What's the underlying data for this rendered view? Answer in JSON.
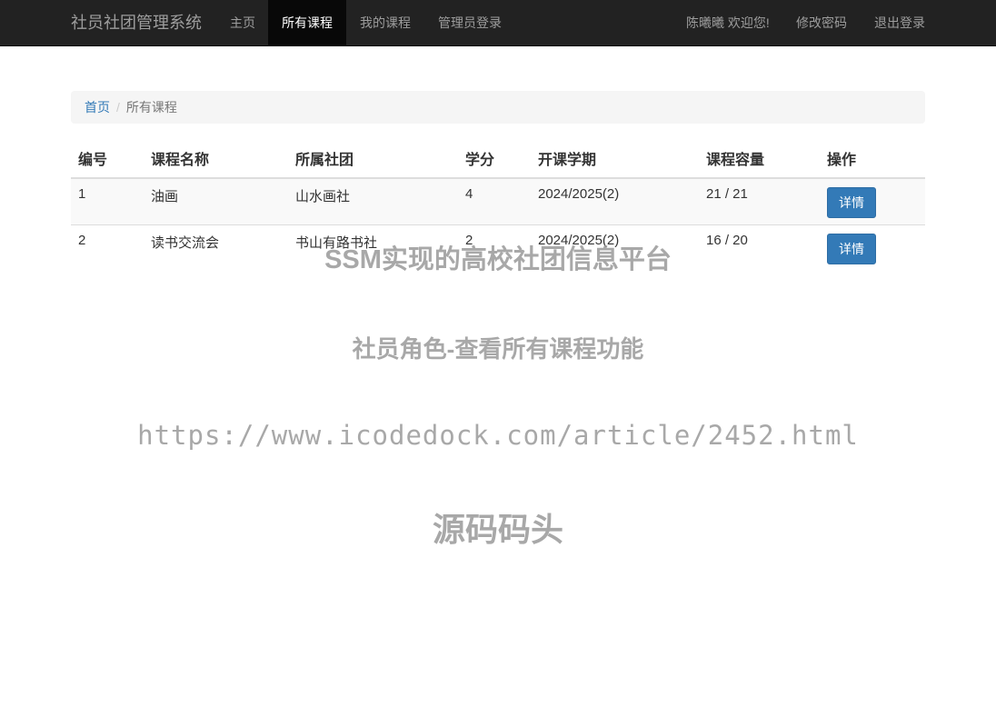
{
  "navbar": {
    "brand": "社员社团管理系统",
    "items": [
      {
        "label": "主页",
        "active": false
      },
      {
        "label": "所有课程",
        "active": true
      },
      {
        "label": "我的课程",
        "active": false
      },
      {
        "label": "管理员登录",
        "active": false
      }
    ],
    "user_greeting": "陈曦曦 欢迎您!",
    "change_password": "修改密码",
    "logout": "退出登录"
  },
  "breadcrumb": {
    "home": "首页",
    "separator": "/",
    "current": "所有课程"
  },
  "table": {
    "headers": [
      "编号",
      "课程名称",
      "所属社团",
      "学分",
      "开课学期",
      "课程容量",
      "操作"
    ],
    "rows": [
      {
        "id": "1",
        "name": "油画",
        "club": "山水画社",
        "credit": "4",
        "semester": "2024/2025(2)",
        "capacity": "21 / 21",
        "action": "详情"
      },
      {
        "id": "2",
        "name": "读书交流会",
        "club": "书山有路书社",
        "credit": "2",
        "semester": "2024/2025(2)",
        "capacity": "16 / 20",
        "action": "详情"
      }
    ]
  },
  "watermark": {
    "line1": "SSM实现的高校社团信息平台",
    "line2": "社员角色-查看所有课程功能",
    "line3": "https://www.icodedock.com/article/2452.html",
    "line4": "源码码头"
  },
  "colors": {
    "navbar_bg": "#222222",
    "nav_active_bg": "#080808",
    "link": "#337ab7",
    "button_primary": "#337ab7"
  }
}
